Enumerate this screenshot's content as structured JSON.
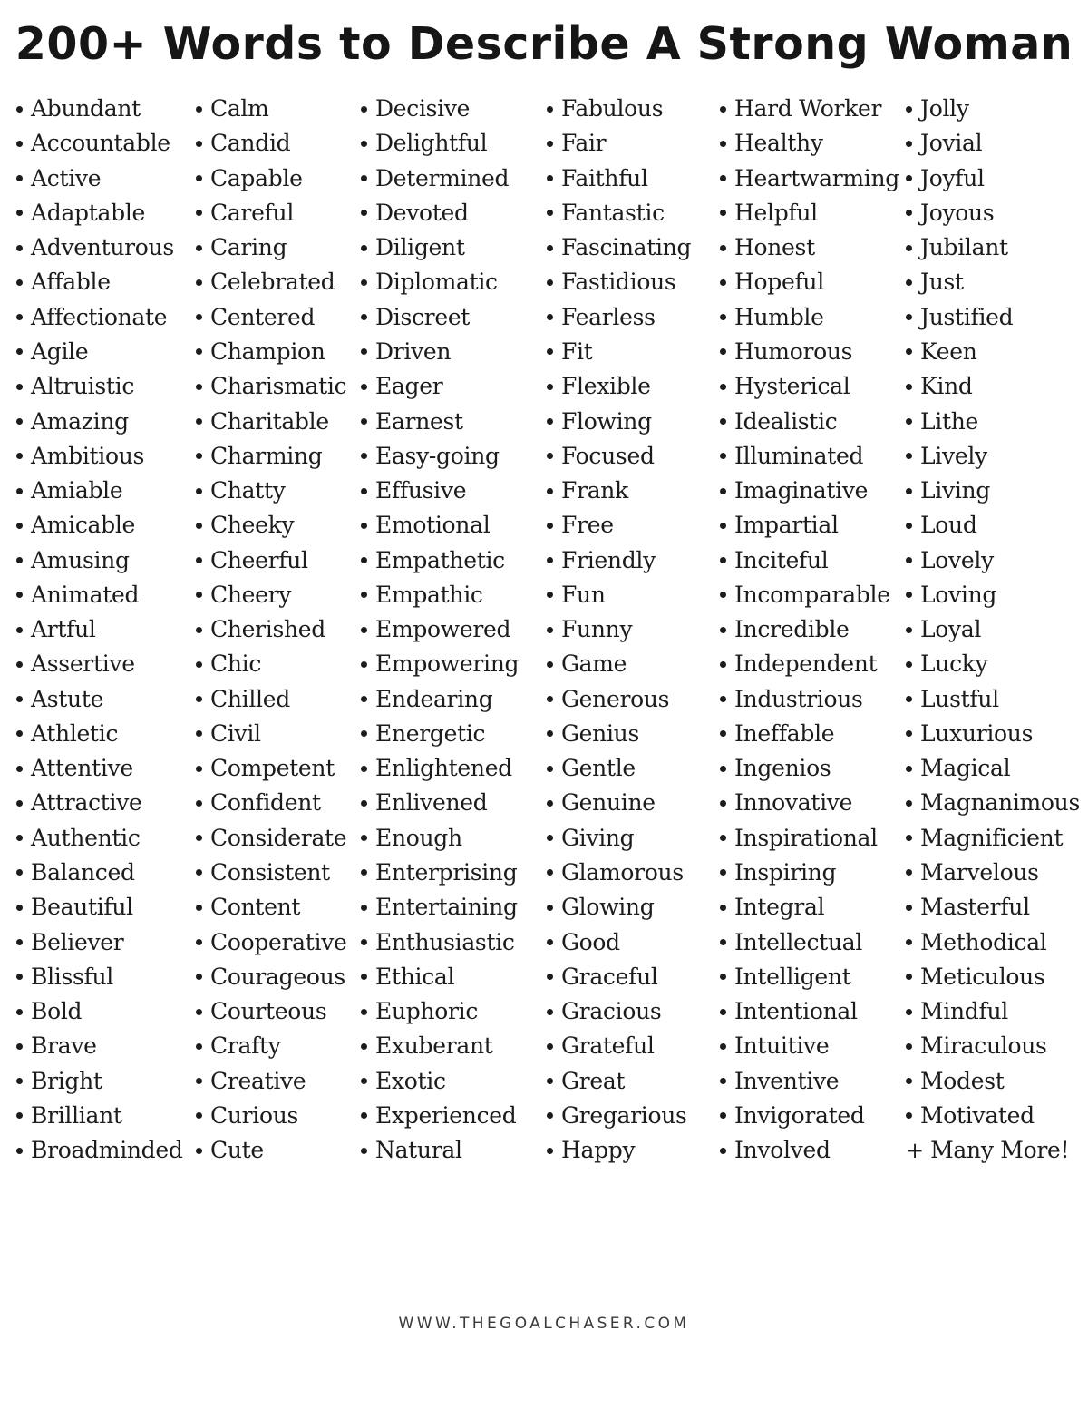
{
  "title": "200+ Words to Describe A Strong Woman",
  "columns": [
    [
      "Abundant",
      "Accountable",
      "Active",
      "Adaptable",
      "Adventurous",
      "Affable",
      "Affectionate",
      "Agile",
      "Altruistic",
      "Amazing",
      "Ambitious",
      "Amiable",
      "Amicable",
      "Amusing",
      "Animated",
      "Artful",
      "Assertive",
      "Astute",
      "Athletic",
      "Attentive",
      "Attractive",
      "Authentic",
      "Balanced",
      "Beautiful",
      "Believer",
      "Blissful",
      "Bold",
      "Brave",
      "Bright",
      "Brilliant",
      "Broadminded"
    ],
    [
      "Calm",
      "Candid",
      "Capable",
      "Careful",
      "Caring",
      "Celebrated",
      "Centered",
      "Champion",
      "Charismatic",
      "Charitable",
      "Charming",
      "Chatty",
      "Cheeky",
      "Cheerful",
      "Cheery",
      "Cherished",
      "Chic",
      "Chilled",
      "Civil",
      "Competent",
      "Confident",
      "Considerate",
      "Consistent",
      "Content",
      "Cooperative",
      "Courageous",
      "Courteous",
      "Crafty",
      "Creative",
      "Curious",
      "Cute"
    ],
    [
      "Decisive",
      "Delightful",
      "Determined",
      "Devoted",
      "Diligent",
      "Diplomatic",
      "Discreet",
      "Driven",
      "Eager",
      "Earnest",
      "Easy-going",
      "Effusive",
      "Emotional",
      "Empathetic",
      "Empathic",
      "Empowered",
      "Empowering",
      "Endearing",
      "Energetic",
      "Enlightened",
      "Enlivened",
      "Enough",
      "Enterprising",
      "Entertaining",
      "Enthusiastic",
      "Ethical",
      "Euphoric",
      "Exuberant",
      "Exotic",
      "Experienced",
      "Natural"
    ],
    [
      "Fabulous",
      "Fair",
      "Faithful",
      "Fantastic",
      "Fascinating",
      "Fastidious",
      "Fearless",
      "Fit",
      "Flexible",
      "Flowing",
      "Focused",
      "Frank",
      "Free",
      "Friendly",
      "Fun",
      "Funny",
      "Game",
      "Generous",
      "Genius",
      "Gentle",
      "Genuine",
      "Giving",
      "Glamorous",
      "Glowing",
      "Good",
      "Graceful",
      "Gracious",
      "Grateful",
      "Great",
      "Gregarious",
      "Happy"
    ],
    [
      "Hard Worker",
      "Healthy",
      "Heartwarming",
      "Helpful",
      "Honest",
      "Hopeful",
      "Humble",
      "Humorous",
      "Hysterical",
      "Idealistic",
      "Illuminated",
      "Imaginative",
      "Impartial",
      "Inciteful",
      "Incomparable",
      "Incredible",
      "Independent",
      "Industrious",
      "Ineffable",
      "Ingenios",
      "Innovative",
      "Inspirational",
      "Inspiring",
      "Integral",
      "Intellectual",
      "Intelligent",
      "Intentional",
      "Intuitive",
      "Inventive",
      "Invigorated",
      "Involved"
    ],
    [
      "Jolly",
      "Jovial",
      "Joyful",
      "Joyous",
      "Jubilant",
      "Just",
      "Justified",
      "Keen",
      "Kind",
      "Lithe",
      "Lively",
      "Living",
      "Loud",
      "Lovely",
      "Loving",
      "Loyal",
      "Lucky",
      "Lustful",
      "Luxurious",
      "Magical",
      "Magnanimous",
      "Magnificient",
      "Marvelous",
      "Masterful",
      "Methodical",
      "Meticulous",
      "Mindful",
      "Miraculous",
      "Modest",
      "Motivated"
    ]
  ],
  "more": {
    "symbol": "+",
    "label": "Many More!"
  },
  "footer": "WWW.THEGOALCHASER.COM"
}
